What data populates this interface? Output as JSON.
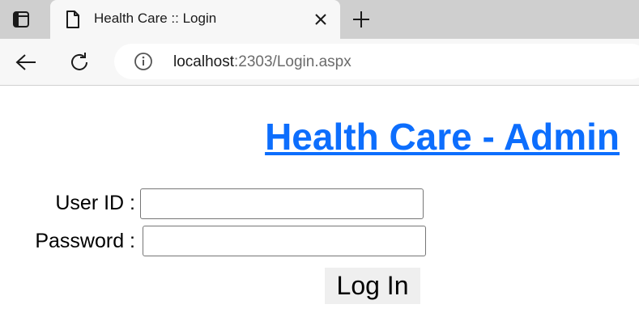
{
  "browser": {
    "tab": {
      "title": "Health Care :: Login"
    },
    "address_bar": {
      "host": "localhost",
      "rest": ":2303/Login.aspx"
    }
  },
  "page": {
    "heading": "Health Care - Admin",
    "user_id_label": "User ID :",
    "password_label": "Password :",
    "user_id_value": "",
    "password_value": "",
    "login_button": "Log In"
  },
  "icons": {
    "tab_actions": "tab-actions-icon",
    "page": "page-icon",
    "close": "close-icon",
    "new_tab": "plus-icon",
    "back": "back-arrow-icon",
    "reload": "reload-icon",
    "site_info": "info-icon"
  }
}
